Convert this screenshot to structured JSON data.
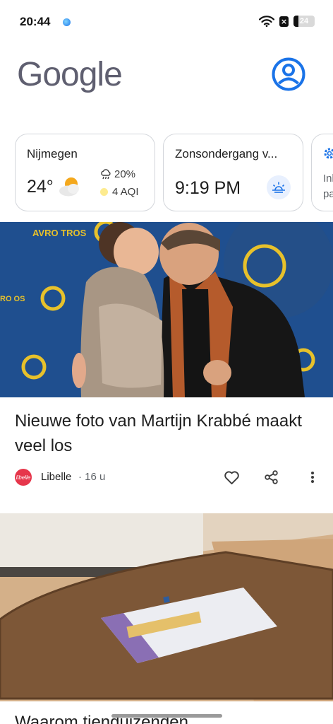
{
  "status_bar": {
    "time": "20:44",
    "battery_level": "24",
    "battery_fraction": 0.24
  },
  "header": {
    "logo_text": "Google",
    "account_icon": "account-circle-icon"
  },
  "cards": {
    "weather": {
      "city": "Nijmegen",
      "temperature": "24°",
      "condition_icon": "partly-cloudy-icon",
      "precipitation": "20%",
      "aqi": "4 AQI"
    },
    "sunset": {
      "title": "Zonsondergang v...",
      "time": "9:19 PM",
      "icon": "sunset-icon"
    },
    "third": {
      "icon": "settings-icon",
      "text_line1": "Inl",
      "text_line2": "pa"
    }
  },
  "articles": [
    {
      "headline": "Nieuwe foto van Martijn Krabbé maakt veel los",
      "source": "Libelle",
      "source_logo_text": "libelle",
      "age": "· 16 u",
      "image_text": {
        "backdrop_logo_1": "AVRO TROS",
        "backdrop_logo_2": "RO OS"
      }
    },
    {
      "headline": "Waarom tienduizenden"
    }
  ],
  "colors": {
    "accent_blue": "#1a73e8",
    "backdrop_blue": "#1f4f8f",
    "backdrop_yellow": "#e7c12b",
    "libelle_red": "#e6364b"
  }
}
